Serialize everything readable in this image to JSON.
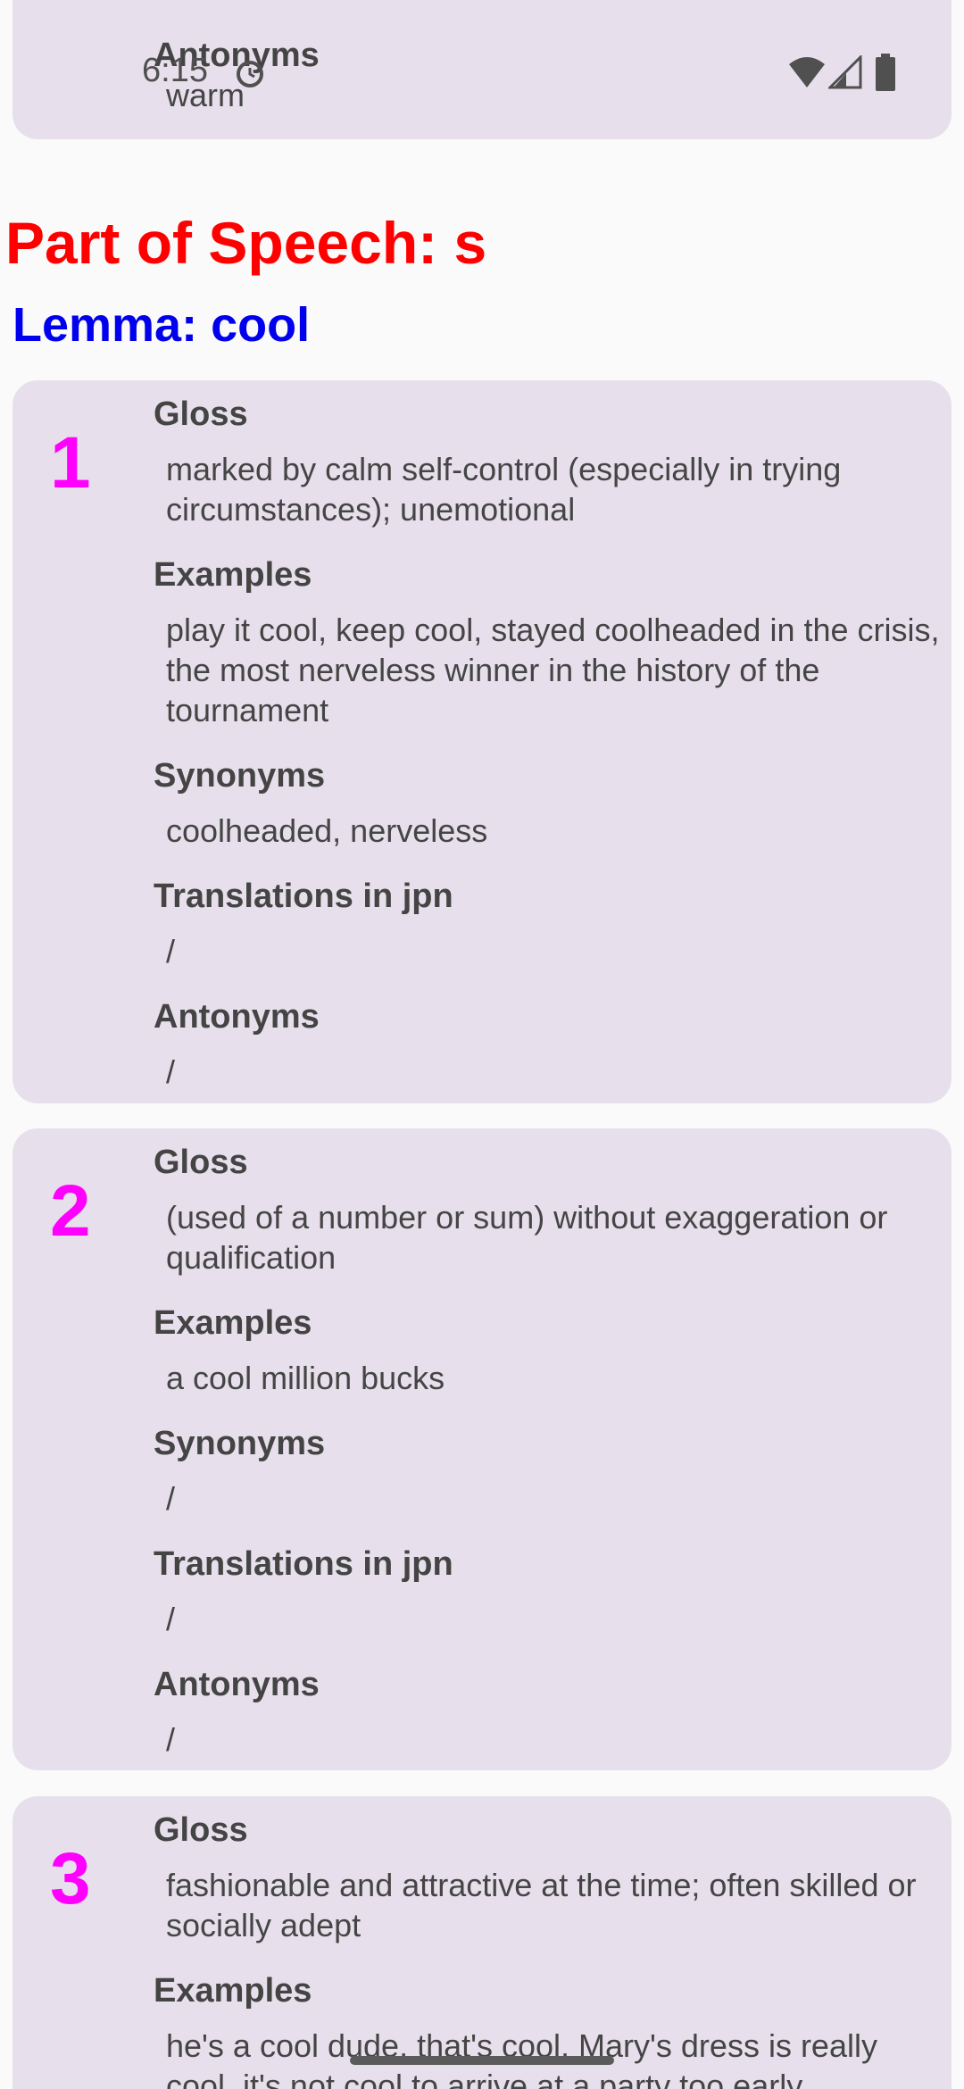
{
  "status_bar": {
    "time": "6:15",
    "icons": [
      "alarm-icon",
      "wifi-icon",
      "cell-signal-icon",
      "battery-icon"
    ]
  },
  "previous_card": {
    "antonyms_heading": "Antonyms",
    "antonyms_value": "warm"
  },
  "part_of_speech": "Part of Speech: s",
  "lemma": "Lemma: cool",
  "senses": [
    {
      "number": "1",
      "gloss_heading": "Gloss",
      "gloss": "marked by calm self-control (especially in trying circumstances); unemotional",
      "examples_heading": "Examples",
      "examples": "play it cool, keep cool, stayed coolheaded in the crisis, the most nerveless winner in the history of the tournament",
      "synonyms_heading": "Synonyms",
      "synonyms": "coolheaded, nerveless",
      "translations_heading": "Translations in jpn",
      "translations": "/",
      "antonyms_heading": "Antonyms",
      "antonyms": "/"
    },
    {
      "number": "2",
      "gloss_heading": "Gloss",
      "gloss": "(used of a number or sum) without exaggeration or qualification",
      "examples_heading": "Examples",
      "examples": "a cool million bucks",
      "synonyms_heading": "Synonyms",
      "synonyms": "/",
      "translations_heading": "Translations in jpn",
      "translations": "/",
      "antonyms_heading": "Antonyms",
      "antonyms": "/"
    },
    {
      "number": "3",
      "gloss_heading": "Gloss",
      "gloss": "fashionable and attractive at the time; often skilled or socially adept",
      "examples_heading": "Examples",
      "examples": "he's a cool dude, that's cool, Mary's dress is really cool, it's not cool to arrive at a party too early"
    }
  ],
  "colors": {
    "part_of_speech": "#ff0000",
    "lemma": "#0000ee",
    "sense_number": "#ff00ff",
    "card_background": "#e7e0ec"
  }
}
